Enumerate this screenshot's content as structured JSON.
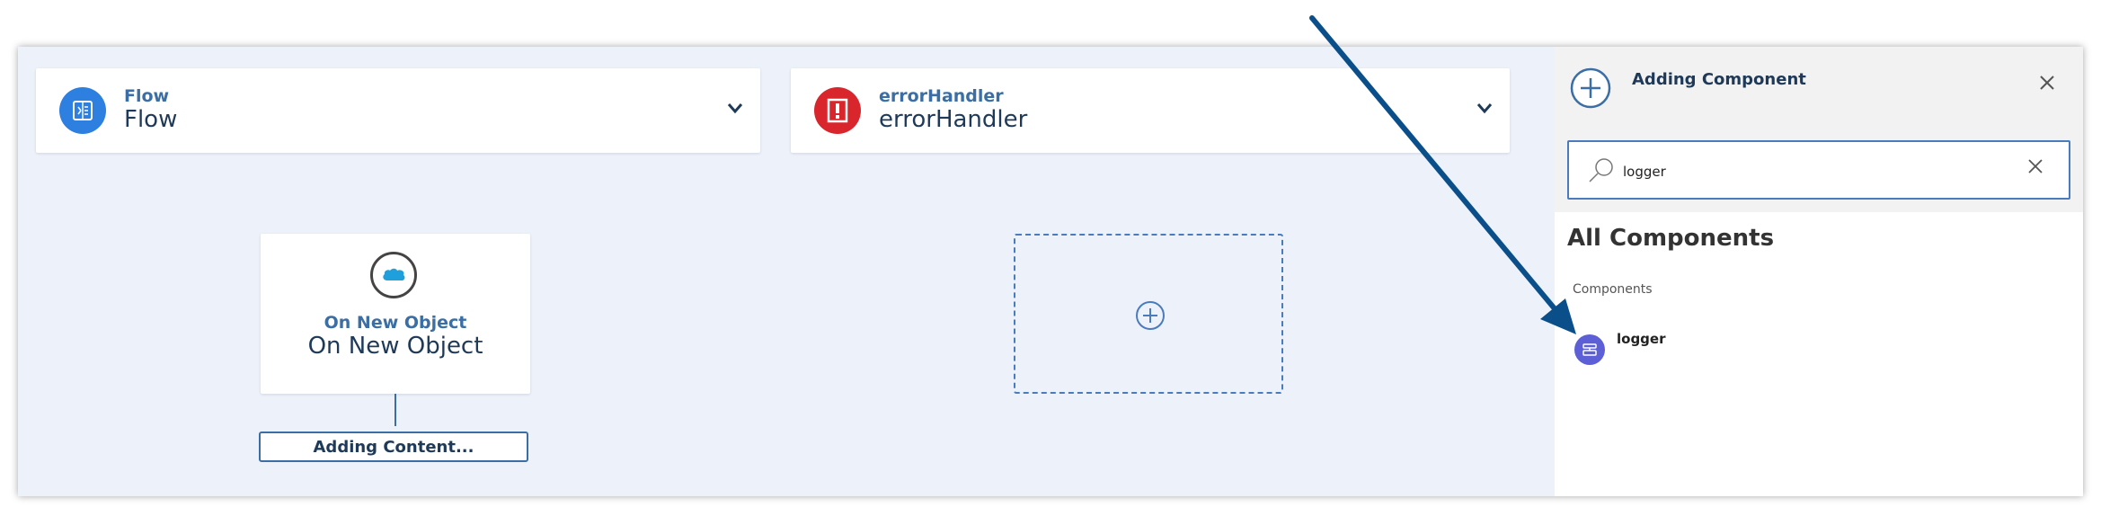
{
  "flow_card": {
    "subtitle": "Flow",
    "title": "Flow",
    "icon": "flow-icon",
    "color": "#2d7fe0"
  },
  "error_card": {
    "subtitle": "errorHandler",
    "title": "errorHandler",
    "icon": "error-handler-icon",
    "color": "#d9262d"
  },
  "source_node": {
    "subtitle": "On New Object",
    "title": "On New Object",
    "icon": "salesforce-icon"
  },
  "adding_content": {
    "label": "Adding Content..."
  },
  "placeholder": {
    "icon": "add-circle-icon"
  },
  "panel": {
    "title": "Adding Component",
    "search": {
      "value": "logger",
      "placeholder": ""
    },
    "section_title": "All Components",
    "section_subtitle": "Components",
    "items": [
      {
        "label": "logger",
        "icon": "logger-icon",
        "color": "#5c5fd6"
      }
    ]
  },
  "colors": {
    "accent": "#4a7bbd",
    "canvas": "#edf2fa",
    "arrow": "#0a4f8a"
  }
}
